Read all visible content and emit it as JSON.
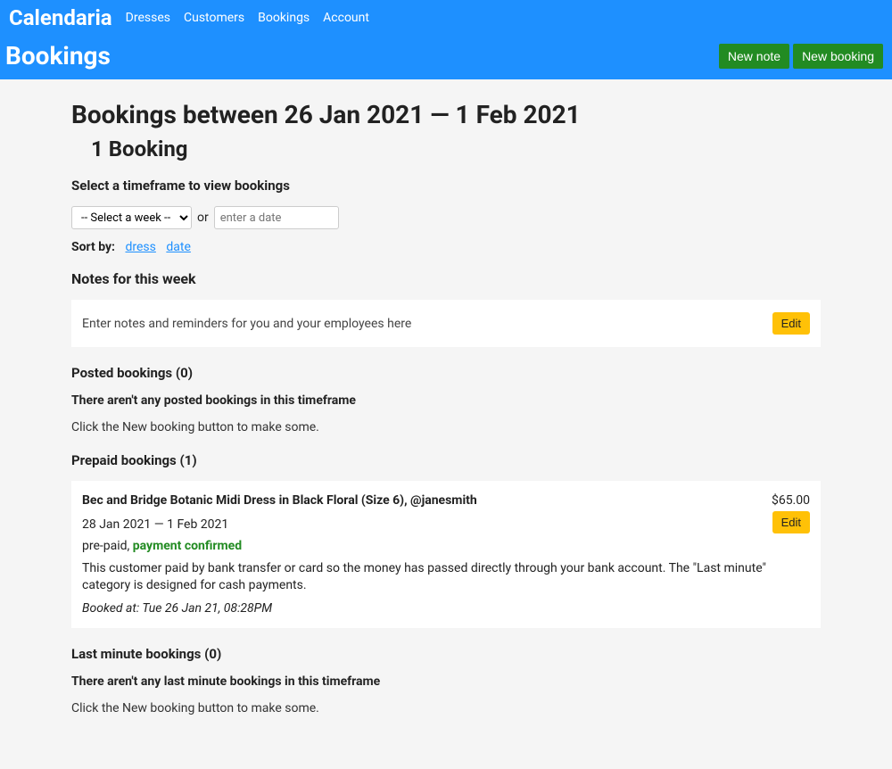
{
  "navbar": {
    "brand": "Calendaria",
    "links": [
      "Dresses",
      "Customers",
      "Bookings",
      "Account"
    ]
  },
  "subheader": {
    "title": "Bookings",
    "new_note": "New note",
    "new_booking": "New booking"
  },
  "page": {
    "title": "Bookings between 26 Jan 2021 — 1 Feb 2021",
    "count": "1 Booking",
    "timeframe_label": "Select a timeframe to view bookings",
    "week_select": "-- Select a week --",
    "or_text": "or",
    "date_placeholder": "enter a date",
    "sort_label": "Sort by:",
    "sort_dress": "dress",
    "sort_date": "date"
  },
  "notes": {
    "header": "Notes for this week",
    "text": "Enter notes and reminders for you and your employees here",
    "edit": "Edit"
  },
  "posted": {
    "header": "Posted bookings (0)",
    "empty_title": "There aren't any posted bookings in this timeframe",
    "empty_hint": "Click the New booking button to make some."
  },
  "prepaid": {
    "header": "Prepaid bookings (1)",
    "booking": {
      "title": "Bec and Bridge Botanic Midi Dress in Black Floral (Size 6), @janesmith",
      "price": "$65.00",
      "dates": "28 Jan 2021 — 1 Feb 2021",
      "pay_prefix": "pre-paid, ",
      "pay_status": "payment confirmed",
      "desc": "This customer paid by bank transfer or card so the money has passed directly through your bank account. The \"Last minute\" category is designed for cash payments.",
      "booked_at": "Booked at: Tue 26 Jan 21, 08:28PM",
      "edit": "Edit"
    }
  },
  "lastminute": {
    "header": "Last minute bookings (0)",
    "empty_title": "There aren't any last minute bookings in this timeframe",
    "empty_hint": "Click the New booking button to make some."
  }
}
